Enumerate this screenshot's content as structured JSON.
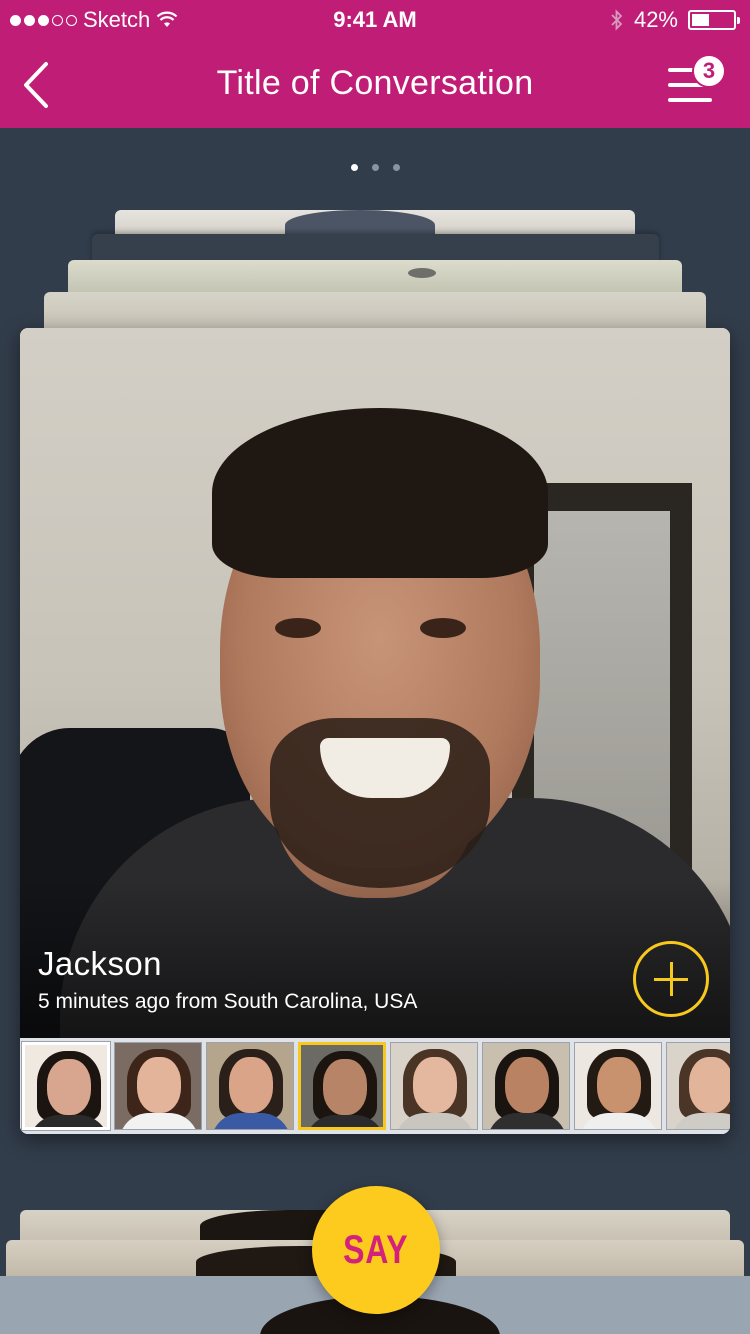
{
  "status_bar": {
    "carrier": "Sketch",
    "time": "9:41 AM",
    "battery": "42%",
    "battery_level": 0.42,
    "signal_bars_filled": 3,
    "signal_bars_total": 5
  },
  "nav": {
    "title": "Title of Conversation",
    "badge_count": "3",
    "back_icon": "chevron-left-icon",
    "menu_icon": "menu-icon"
  },
  "pager": {
    "pages": 3,
    "active": 0
  },
  "video": {
    "name": "Jackson",
    "meta": "5 minutes ago from South Carolina, USA",
    "add_icon": "plus-circle-icon"
  },
  "thumbnails": [
    {
      "skin": "#d8a58e",
      "hair": "#1b1410",
      "bg": "#efe9e2",
      "shirt": "#2a2a2a"
    },
    {
      "skin": "#e3b49a",
      "hair": "#3d2619",
      "bg": "#7b6c63",
      "shirt": "#f2f2f2"
    },
    {
      "skin": "#d9a487",
      "hair": "#2b2019",
      "bg": "#b4a58c",
      "shirt": "#3b5aa6"
    },
    {
      "skin": "#b78468",
      "hair": "#1c140f",
      "bg": "#6c6a64",
      "shirt": "#2b2b2d"
    },
    {
      "skin": "#e4b89e",
      "hair": "#4a3426",
      "bg": "#d8d2c8",
      "shirt": "#c9c6c0"
    },
    {
      "skin": "#b98363",
      "hair": "#1a1410",
      "bg": "#c9bfae",
      "shirt": "#2f2f30"
    },
    {
      "skin": "#c9926e",
      "hair": "#241a14",
      "bg": "#ece8e1",
      "shirt": "#efefef"
    },
    {
      "skin": "#e2b59a",
      "hair": "#4b3527",
      "bg": "#d9d3ca",
      "shirt": "#cfccc6"
    }
  ],
  "selected_thumbnail": 3,
  "say_button": {
    "label": "SAY"
  },
  "colors": {
    "accent": "#c01e76",
    "yellow": "#fccb1e",
    "background": "#323d4b"
  }
}
